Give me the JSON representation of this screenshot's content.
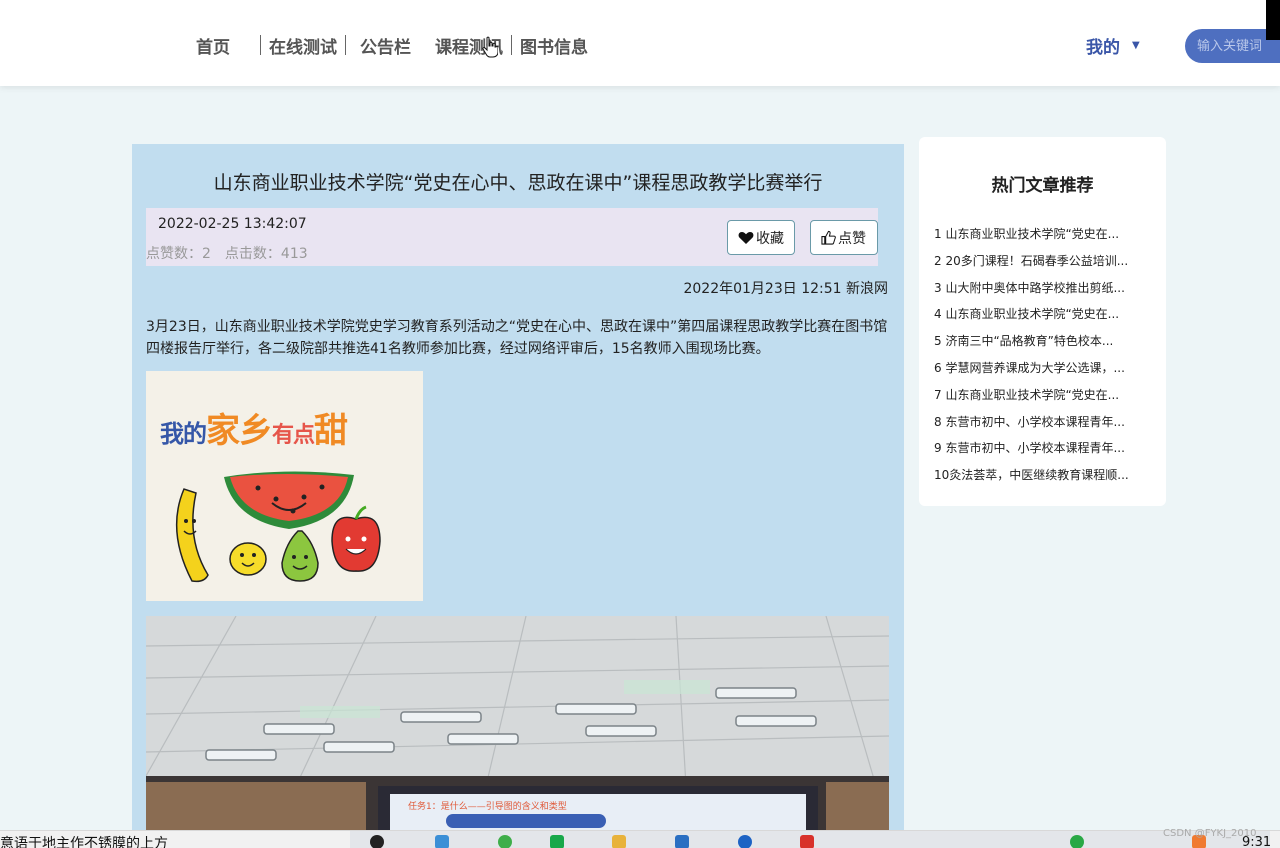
{
  "nav": {
    "items": [
      "首页",
      "在线测试",
      "公告栏",
      "课程测讯",
      "图书信息"
    ],
    "my_label": "我的",
    "search_placeholder": "输入关键词"
  },
  "article": {
    "title": "山东商业职业技术学院“党史在心中、思政在课中”课程思政教学比赛举行",
    "datetime": "2022-02-25 13:42:07",
    "likes_label": "点赞数：2",
    "clicks_label": "点击数：413",
    "fav_button": "收藏",
    "like_button": "点赞",
    "source": "2022年01月23日 12:51 新浪网",
    "body": "3月23日，山东商业职业技术学院党史学习教育系列活动之“党史在心中、思政在课中”第四届课程思政教学比赛在图书馆四楼报告厅举行，各二级院部共推选41名教师参加比赛，经过网络评审后，15名教师入围现场比赛。",
    "image1_text": {
      "a": "我的",
      "b": "家乡",
      "c": "有点",
      "d": "甜"
    },
    "image2_banner": "任务1：是什么——引导图的含义和类型"
  },
  "side": {
    "title": "热门文章推荐",
    "items": [
      "1  山东商业职业技术学院“党史在...",
      "2  20多门课程！石碣春季公益培训...",
      "3  山大附中奥体中路学校推出剪纸...",
      "4  山东商业职业技术学院“党史在...",
      "5  济南三中“品格教育”特色校本...",
      "6  学慧网营养课成为大学公选课，...",
      "7  山东商业职业技术学院“党史在...",
      "8  东营市初中、小学校本课程青年...",
      "9  东营市初中、小学校本课程青年...",
      "10灸法荟萃，中医继续教育课程顺..."
    ]
  },
  "taskbar": {
    "left_text": "意语于地主作不锈膜的上方",
    "clock": "9:31",
    "watermark": "CSDN @FYKJ_2010"
  },
  "colors": {
    "accent": "#3a56a8",
    "article_bg": "#c1ddef",
    "meta_bg": "#e9e4f2",
    "page_bg": "#edf5f7"
  }
}
